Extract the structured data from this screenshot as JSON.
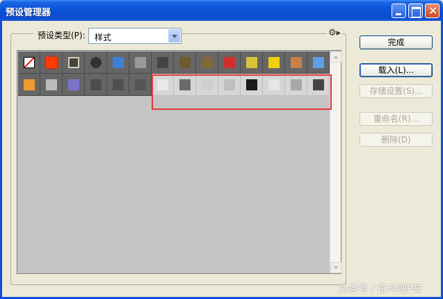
{
  "window": {
    "title": "预设管理器"
  },
  "preset_type": {
    "label": "预设类型(P):",
    "value": "样式"
  },
  "buttons": {
    "done": "完成",
    "load": "载入(L)...",
    "save": "存储设置(S)...",
    "rename": "重命名(R)...",
    "delete": "删除(D)"
  },
  "watermark": "头条号 / 奋斗吧P车",
  "styles_row1": [
    {
      "name": "none-style",
      "color": "#ffffff"
    },
    {
      "name": "red-glow-style",
      "color": "#ff3b00"
    },
    {
      "name": "outline-style",
      "color": "#8a8a8a"
    },
    {
      "name": "dark-circle-style",
      "color": "#333333"
    },
    {
      "name": "blue-glass-style",
      "color": "#3f7fd6"
    },
    {
      "name": "gray-style",
      "color": "#9a9a9a"
    },
    {
      "name": "dark-bevel-style",
      "color": "#444444"
    },
    {
      "name": "brown-style",
      "color": "#6b5b2e"
    },
    {
      "name": "bronze-style",
      "color": "#7d6a3a"
    },
    {
      "name": "red-stripes-style",
      "color": "#d22e2e"
    },
    {
      "name": "rainbow-style",
      "color": "#d9c33a"
    },
    {
      "name": "yellow-style",
      "color": "#f1d10c"
    },
    {
      "name": "orange-style",
      "color": "#c97f4a"
    },
    {
      "name": "sky-style",
      "color": "#5aa0e6"
    }
  ],
  "styles_row2": [
    {
      "name": "landscape-style",
      "color": "#f09a33",
      "light": false
    },
    {
      "name": "noise-style",
      "color": "#bcbcbc",
      "light": false
    },
    {
      "name": "purple-style",
      "color": "#7a74c9",
      "light": false
    },
    {
      "name": "dark-square-style",
      "color": "#4d4d4d",
      "light": false
    },
    {
      "name": "dark-square-2-style",
      "color": "#505050",
      "light": false
    },
    {
      "name": "dark-square-3-style",
      "color": "#555555",
      "light": false
    },
    {
      "name": "shine-style",
      "color": "#e8e8e8",
      "light": true
    },
    {
      "name": "checker-style",
      "color": "#6a6a6a",
      "light": true
    },
    {
      "name": "light-box-style",
      "color": "#cfcfcf",
      "light": true
    },
    {
      "name": "framed-box-style",
      "color": "#bfbfbf",
      "light": true
    },
    {
      "name": "black-corner-style",
      "color": "#1a1a1a",
      "light": true
    },
    {
      "name": "fold-style",
      "color": "#e6e6e6",
      "light": true
    },
    {
      "name": "frame-style",
      "color": "#a8a8a8",
      "light": true
    },
    {
      "name": "dark-frame-style",
      "color": "#444444",
      "light": true
    }
  ]
}
